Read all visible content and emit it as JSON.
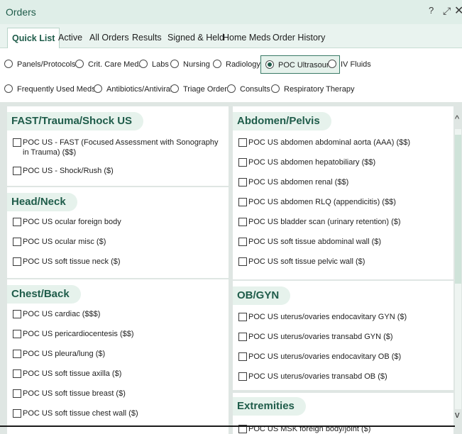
{
  "window": {
    "title": "Orders",
    "help_symbol": "?",
    "expand_symbol": "⤢",
    "close_symbol": "✕"
  },
  "tabs": [
    {
      "label": "Quick List",
      "active": true
    },
    {
      "label": "Active"
    },
    {
      "label": "All Orders"
    },
    {
      "label": "Results"
    },
    {
      "label": "Signed & Held"
    },
    {
      "label": "Home Meds"
    },
    {
      "label": "Order History"
    }
  ],
  "filters": {
    "row1": [
      {
        "label": "Panels/Protocols"
      },
      {
        "label": "Crit. Care Meds"
      },
      {
        "label": "Labs"
      },
      {
        "label": "Nursing"
      },
      {
        "label": "Radiology"
      },
      {
        "label": "POC Ultrasound",
        "selected": true
      },
      {
        "label": "IV Fluids"
      }
    ],
    "row2": [
      {
        "label": "Frequently Used Meds"
      },
      {
        "label": "Antibiotics/Antivirals"
      },
      {
        "label": "Triage Orders"
      },
      {
        "label": "Consults"
      },
      {
        "label": "Respiratory Therapy"
      }
    ]
  },
  "sections": {
    "fast": {
      "title": "FAST/Trauma/Shock US",
      "items": [
        "POC US - FAST (Focused Assessment with Sonography in Trauma) ($$)",
        "POC US - Shock/Rush ($)"
      ]
    },
    "head": {
      "title": "Head/Neck",
      "items": [
        "POC US ocular foreign body",
        "POC US ocular misc ($)",
        "POC US soft tissue neck ($)"
      ]
    },
    "chest": {
      "title": "Chest/Back",
      "items": [
        "POC US cardiac ($$$)",
        "POC US pericardiocentesis ($$)",
        "POC US pleura/lung ($)",
        "POC US soft tissue axilla ($)",
        "POC US soft tissue breast ($)",
        "POC US soft tissue chest wall ($)"
      ]
    },
    "abdomen": {
      "title": "Abdomen/Pelvis",
      "items": [
        "POC US abdomen abdominal aorta (AAA) ($$)",
        "POC US abdomen hepatobiliary ($$)",
        "POC US abdomen renal ($$)",
        "POC US abdomen RLQ (appendicitis) ($$)",
        "POC US bladder scan (urinary retention) ($)",
        "POC US soft tissue abdominal wall ($)",
        "POC US soft tissue pelvic wall ($)"
      ]
    },
    "obgyn": {
      "title": "OB/GYN",
      "items": [
        "POC US uterus/ovaries endocavitary GYN ($)",
        "POC US uterus/ovaries transabd GYN ($)",
        "POC US uterus/ovaries endocavitary OB ($)",
        "POC US uterus/ovaries transabd OB ($)"
      ]
    },
    "extremities": {
      "title": "Extremities",
      "items": [
        "POC US MSK foreign body/joint ($)"
      ]
    }
  },
  "scrollbar": {
    "up_symbol": "^",
    "down_symbol": "v"
  }
}
